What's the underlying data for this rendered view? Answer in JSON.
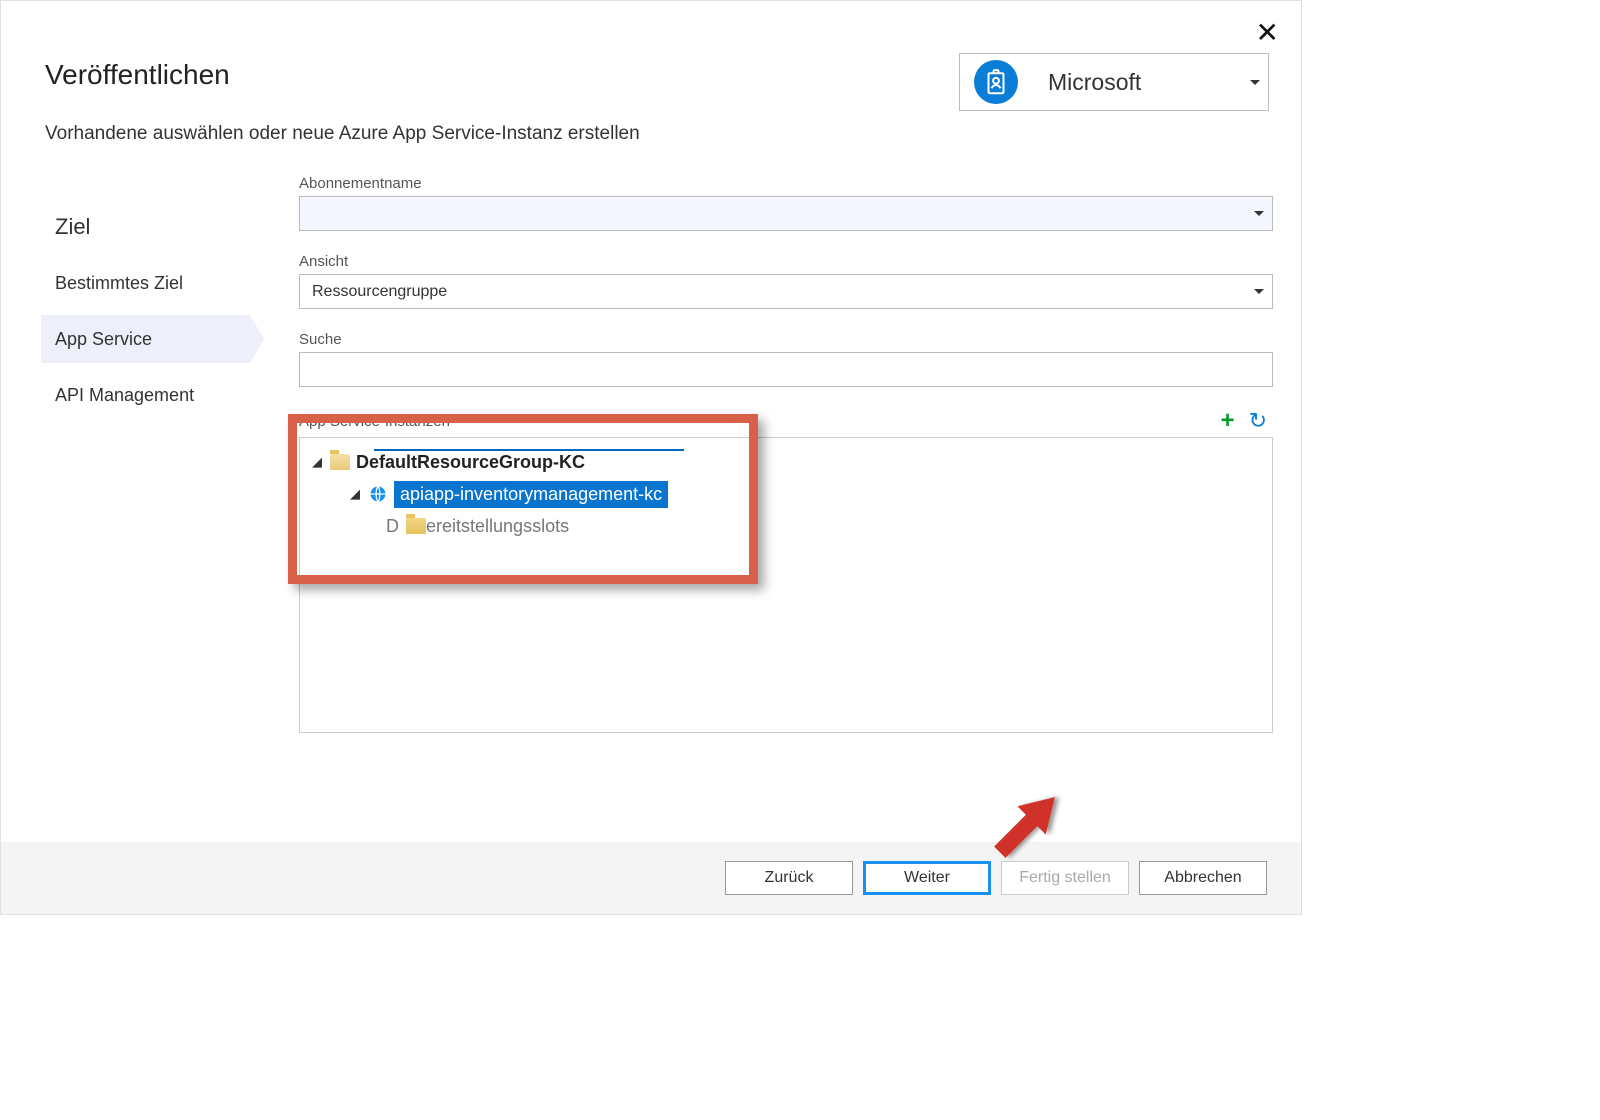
{
  "header": {
    "title": "Veröffentlichen",
    "subtitle": "Vorhandene auswählen oder neue Azure App Service-Instanz erstellen"
  },
  "account": {
    "label": "Microsoft"
  },
  "sidebar": {
    "items": [
      {
        "label": "Ziel",
        "heading": true
      },
      {
        "label": "Bestimmtes Ziel"
      },
      {
        "label": "App Service",
        "active": true
      },
      {
        "label": "API Management"
      }
    ]
  },
  "fields": {
    "subscription_label": "Abonnementname",
    "subscription_value": "",
    "view_label": "Ansicht",
    "view_value": "Ressourcengruppe",
    "search_label": "Suche",
    "search_value": ""
  },
  "instances": {
    "label": "App Service-Instanzen",
    "tree": {
      "resource_group": "DefaultResourceGroup-KC",
      "app": "apiapp-inventorymanagement-kc",
      "slots_prefix": "D",
      "slots_label": "Bereitstellungsslots"
    }
  },
  "footer": {
    "back": "Zurück",
    "next": "Weiter",
    "finish": "Fertig stellen",
    "cancel": "Abbrechen"
  }
}
